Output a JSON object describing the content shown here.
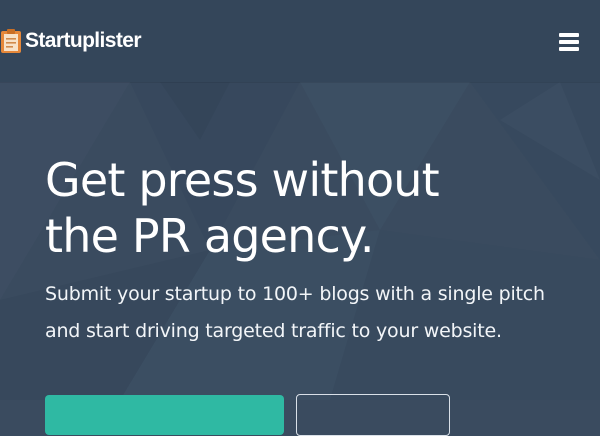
{
  "header": {
    "brand_name": "Startuplister",
    "logo_icon": "clipboard-icon",
    "menu_icon": "hamburger-menu-icon"
  },
  "hero": {
    "headline_line1": "Get press without",
    "headline_line2": "the PR agency.",
    "subhead_line1": "Submit your startup to 100+ blogs with a single pitch",
    "subhead_line2": "and start driving targeted traffic to your website."
  },
  "colors": {
    "background": "#3a4b5f",
    "topbar": "#34465a",
    "accent_teal": "#2fb9a3",
    "logo_orange": "#e6883a",
    "text": "#ffffff"
  }
}
